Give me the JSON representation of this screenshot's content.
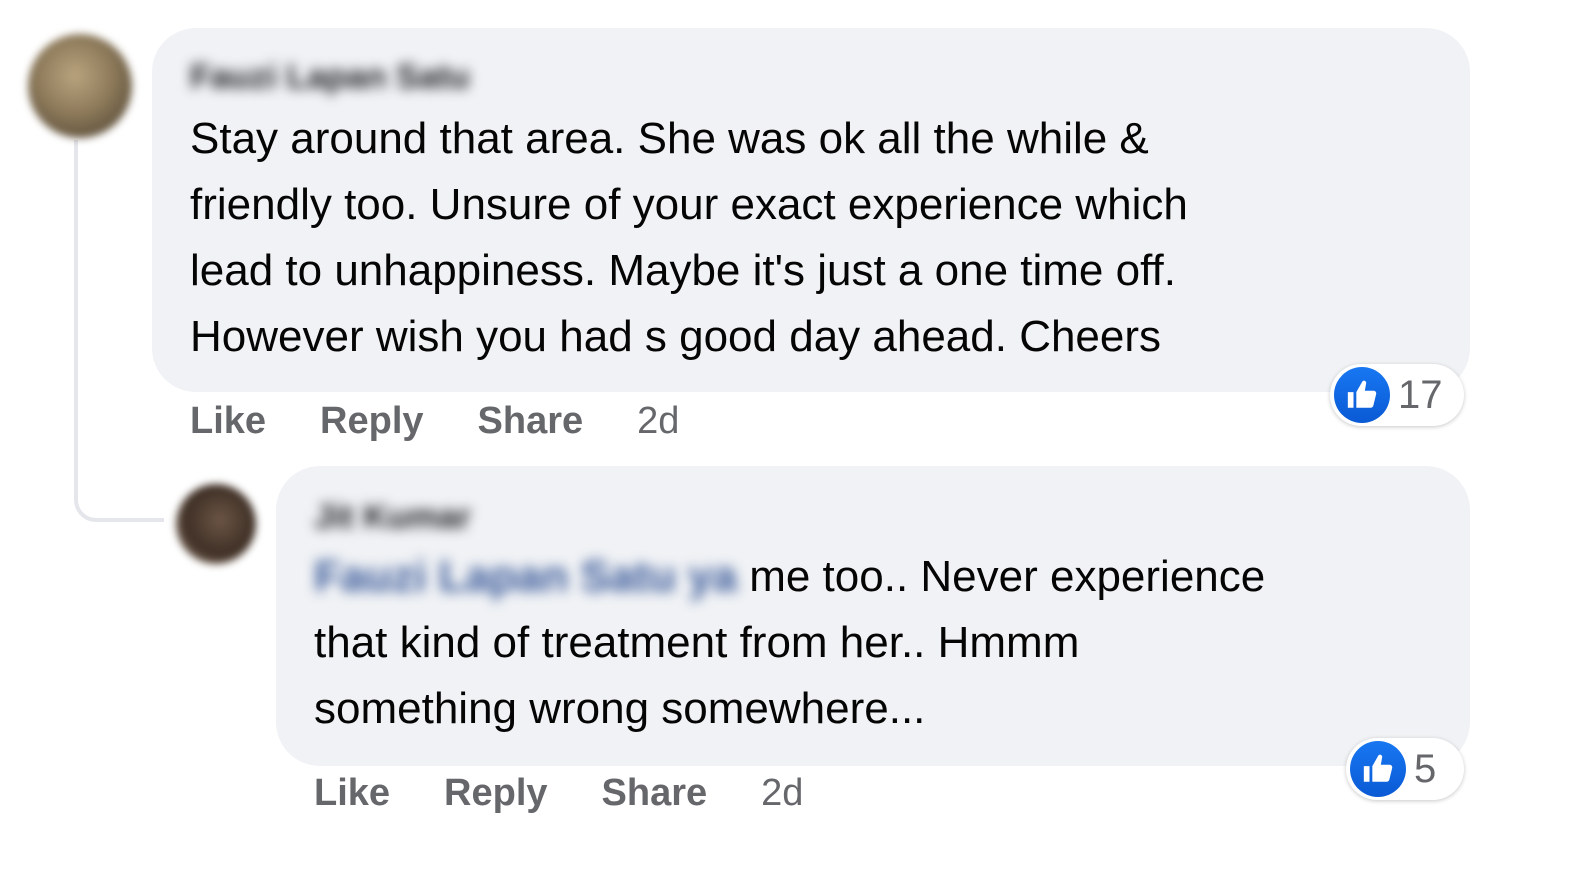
{
  "comments": [
    {
      "author": "Fauzi Lapan Satu",
      "text": "Stay around that area. She was ok all the while &\nfriendly too. Unsure of your exact experience which\nlead to unhappiness. Maybe it's just a one time off.\nHowever wish you had s good day ahead. Cheers",
      "reaction_count": "17",
      "actions": {
        "like": "Like",
        "reply": "Reply",
        "share": "Share",
        "time": "2d"
      }
    },
    {
      "author": "Jit Kumar",
      "mention": "Fauzi Lapan Satu ya",
      "text": " me too.. Never experience\nthat kind of treatment from her.. Hmmm\nsomething wrong somewhere...",
      "reaction_count": "5",
      "actions": {
        "like": "Like",
        "reply": "Reply",
        "share": "Share",
        "time": "2d"
      }
    }
  ],
  "colors": {
    "bubble": "#f0f2f5",
    "like_blue": "#1877f2",
    "secondary_text": "#65676b",
    "primary_text": "#050505"
  },
  "icons": {
    "reaction": "thumbs-up-icon"
  }
}
